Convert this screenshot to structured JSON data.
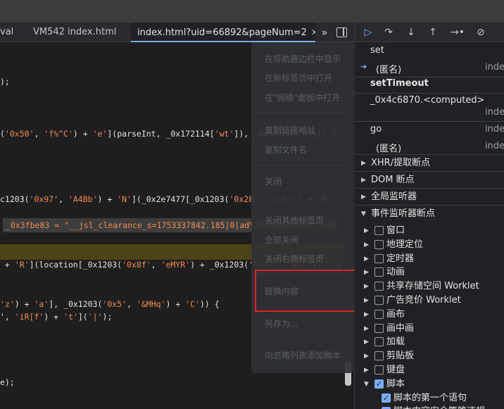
{
  "tabs": [
    {
      "label": "val",
      "active": false
    },
    {
      "label": "VM542 index.html",
      "active": false
    },
    {
      "label": "index.html?uid=66892&pageNum=2",
      "active": true
    }
  ],
  "tab_close_glyph": "✕",
  "tab_overflow_glyph": "»",
  "code_lines": [
    {
      "parts": [
        [
          "",
          ");"
        ]
      ]
    },
    {
      "parts": [
        [
          "",
          "("
        ],
        [
          "s",
          "'0x50'"
        ],
        [
          "",
          ", "
        ],
        [
          "s",
          "'f%^C'"
        ],
        [
          "",
          ") + "
        ],
        [
          "s",
          "'e'"
        ],
        [
          "",
          "](parseInt, _0x172114["
        ],
        [
          "s",
          "'wt'"
        ],
        [
          "",
          "]), _0x3e3b0b[0x1]) ?"
        ]
      ]
    },
    {
      "parts": [
        [
          "",
          "c1203("
        ],
        [
          "s",
          "'0x97'"
        ],
        [
          "",
          ", "
        ],
        [
          "s",
          "'A4Bb'"
        ],
        [
          "",
          ") + "
        ],
        [
          "s",
          "'N'"
        ],
        [
          "",
          "](_0x2e7477[_0x1203("
        ],
        [
          "s",
          "'0x28'"
        ],
        [
          "",
          ", "
        ],
        [
          "s",
          "'Icky'"
        ],
        [
          "",
          ") + "
        ],
        [
          "s",
          "'N'"
        ],
        [
          "",
          "]("
        ]
      ]
    },
    {
      "parts": [
        [
          "",
          " + "
        ],
        [
          "s",
          "'R'"
        ],
        [
          "",
          "](location[_0x1203("
        ],
        [
          "s",
          "'0x8f'"
        ],
        [
          "",
          ", "
        ],
        [
          "s",
          "'eMYR'"
        ],
        [
          "",
          ") + _0x1203("
        ],
        [
          "s",
          "'0x99'"
        ],
        [
          "",
          ", "
        ],
        [
          "s",
          "'8hu'"
        ],
        [
          "",
          ")], lo"
        ]
      ]
    },
    {
      "parts": [
        [
          "s",
          "'z'"
        ],
        [
          "",
          ") + "
        ],
        [
          "s",
          "'a'"
        ],
        [
          "",
          "], _0x1203("
        ],
        [
          "s",
          "'0x5'"
        ],
        [
          "",
          ", "
        ],
        [
          "s",
          "'&MHq'"
        ],
        [
          "",
          ") + "
        ],
        [
          "s",
          "'C'"
        ],
        [
          "",
          ")) {"
        ]
      ]
    },
    {
      "parts": [
        [
          "",
          "', "
        ],
        [
          "s",
          "'iR[f'"
        ],
        [
          "",
          ") + "
        ],
        [
          "s",
          "'t'"
        ],
        [
          "",
          "]("
        ],
        [
          "s",
          "'|'"
        ],
        [
          "",
          ");"
        ]
      ]
    },
    {
      "parts": [
        [
          "",
          "e);"
        ]
      ]
    }
  ],
  "value_preview": "_0x3fbe83 = \"__jsl_clearance_s=1753337842.185|0|adY22c4Bey5%2F7EjsyU",
  "context_menu": [
    "在导航器边栏中显示",
    "在新标签页中打开",
    "在\"网络\"面板中打开",
    "复制链接地址",
    "复制文件名",
    "关闭",
    "关闭其他标签页",
    "全部关闭",
    "关闭右侧标签页",
    "替换内容",
    "另存为...",
    "向忽略列表添加脚本"
  ],
  "debugger_toolbar": {
    "resume": "resume-icon",
    "step_over": "step-over-icon",
    "step_into": "step-into-icon",
    "step_out": "step-out-icon",
    "step": "step-icon",
    "deactivate": "deactivate-breakpoints-icon",
    "glyphs": [
      "▷",
      "↷",
      "↓",
      "↑",
      "→•",
      "⊘"
    ]
  },
  "call_stack": {
    "frames": [
      {
        "name": "set",
        "loc": ""
      },
      {
        "name": "(匿名)",
        "loc": "inde",
        "current": true
      },
      {
        "name": "setTimeout",
        "loc": "",
        "group": true
      },
      {
        "name": "_0x4c6870.<computed>",
        "loc": "inde"
      },
      {
        "name": "go",
        "loc": "inde"
      },
      {
        "name": "(匿名)",
        "loc": "inde"
      }
    ],
    "current_glyph": "➔"
  },
  "sections": [
    {
      "label": "XHR/提取断点",
      "expanded": false
    },
    {
      "label": "DOM 断点",
      "expanded": false
    },
    {
      "label": "全局监听器",
      "expanded": false
    },
    {
      "label": "事件监听器断点",
      "expanded": true
    }
  ],
  "event_categories": [
    {
      "label": "窗口",
      "checked": false,
      "expanded": false
    },
    {
      "label": "地理定位",
      "checked": false,
      "expanded": false
    },
    {
      "label": "定时器",
      "checked": false,
      "expanded": false
    },
    {
      "label": "动画",
      "checked": false,
      "expanded": false
    },
    {
      "label": "共享存储空间 Worklet",
      "checked": false,
      "expanded": false
    },
    {
      "label": "广告竞价 Worklet",
      "checked": false,
      "expanded": false
    },
    {
      "label": "画布",
      "checked": false,
      "expanded": false
    },
    {
      "label": "画中画",
      "checked": false,
      "expanded": false
    },
    {
      "label": "加载",
      "checked": false,
      "expanded": false
    },
    {
      "label": "剪贴板",
      "checked": false,
      "expanded": false
    },
    {
      "label": "键盘",
      "checked": false,
      "expanded": false
    },
    {
      "label": "脚本",
      "checked": true,
      "expanded": true
    },
    {
      "label": "脚本的第一个语句",
      "checked": true,
      "sub": true
    },
    {
      "label": "脚本内容安全策略违规",
      "checked": true,
      "sub": true
    }
  ],
  "collapsed_glyph": "▶",
  "expanded_glyph": "▼"
}
